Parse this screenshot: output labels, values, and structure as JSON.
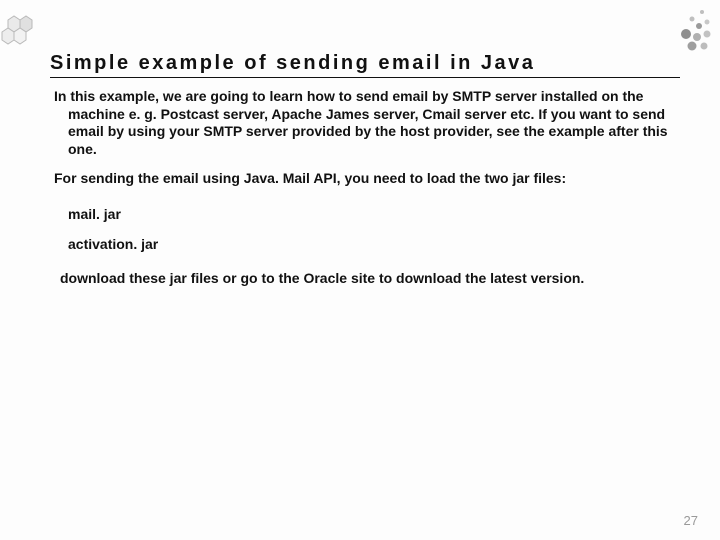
{
  "title": "Simple example of sending email in Java",
  "intro": "In this example, we are going to learn how to send email by SMTP server installed on the machine e. g. Postcast server, Apache James server, Cmail server etc. If you want to send email by using your SMTP server provided by the host provider, see the example after this one.",
  "api_line": "For sending the email using Java. Mail API, you need to load the two jar files:",
  "jars": [
    "mail. jar",
    "activation. jar"
  ],
  "download_line": "download these jar files or go to the Oracle site to download the latest version.",
  "page_number": "27"
}
